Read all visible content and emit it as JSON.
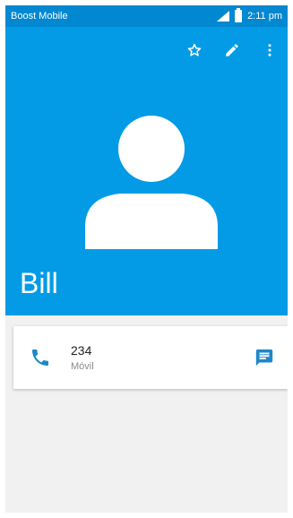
{
  "status_bar": {
    "carrier": "Boost Mobile",
    "time": "2:11 pm"
  },
  "header": {
    "actions": [
      {
        "name": "star-icon"
      },
      {
        "name": "edit-icon"
      },
      {
        "name": "more-vert-icon"
      }
    ],
    "contact_name": "Bill"
  },
  "phone_entry": {
    "number": "234",
    "type": "Móvil"
  },
  "colors": {
    "status_bar": "#0288d1",
    "header": "#039be5",
    "accent_icon": "#1e88c9",
    "background": "#f1f1f1"
  }
}
